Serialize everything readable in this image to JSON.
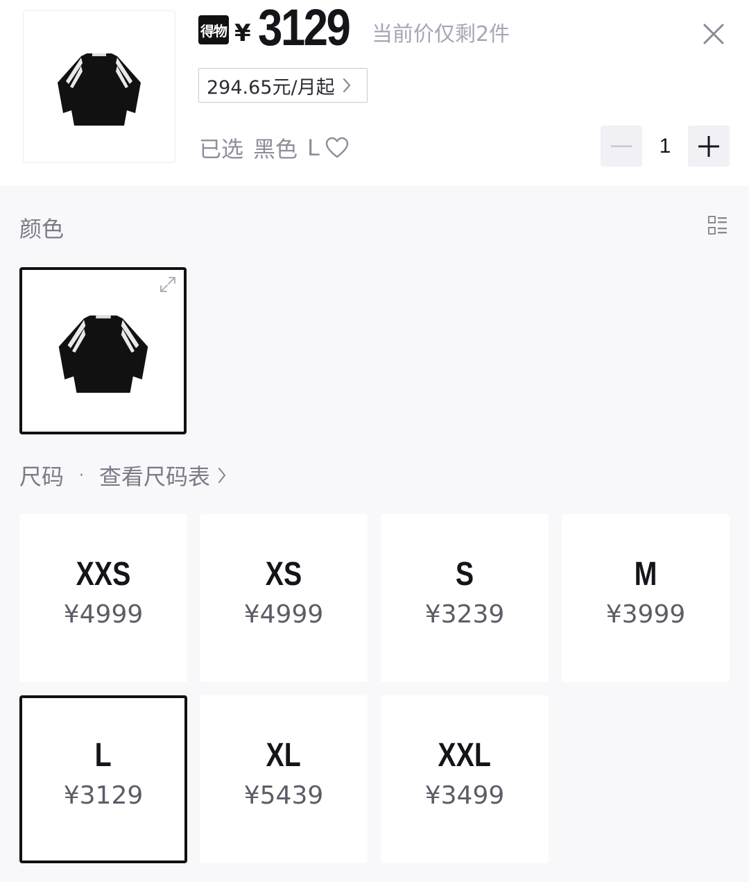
{
  "header": {
    "brand_badge": "得物",
    "currency": "¥",
    "price": "3129",
    "stock_note": "当前价仅剩2件",
    "installment": "294.65元/月起",
    "selected_prefix": "已选",
    "selected_color": "黑色",
    "selected_size": "L",
    "quantity": "1"
  },
  "color_section": {
    "label": "颜色",
    "options": [
      {
        "name": "black-tee",
        "selected": true
      }
    ]
  },
  "size_section": {
    "label": "尺码",
    "separator": "·",
    "size_chart_link": "查看尺码表",
    "sizes": [
      {
        "name": "XXS",
        "price": "¥4999",
        "selected": false
      },
      {
        "name": "XS",
        "price": "¥4999",
        "selected": false
      },
      {
        "name": "S",
        "price": "¥3239",
        "selected": false
      },
      {
        "name": "M",
        "price": "¥3999",
        "selected": false
      },
      {
        "name": "L",
        "price": "¥3129",
        "selected": true
      },
      {
        "name": "XL",
        "price": "¥5439",
        "selected": false
      },
      {
        "name": "XXL",
        "price": "¥3499",
        "selected": false
      }
    ]
  },
  "colors": {
    "selected_border": "#111111",
    "muted_text": "#7b7b88",
    "page_bg": "#f8f8fb",
    "card_bg": "#ffffff"
  },
  "icons": [
    "close-icon",
    "chevron-right-icon",
    "heart-icon",
    "minus-icon",
    "plus-icon",
    "list-layout-icon",
    "expand-icon"
  ]
}
